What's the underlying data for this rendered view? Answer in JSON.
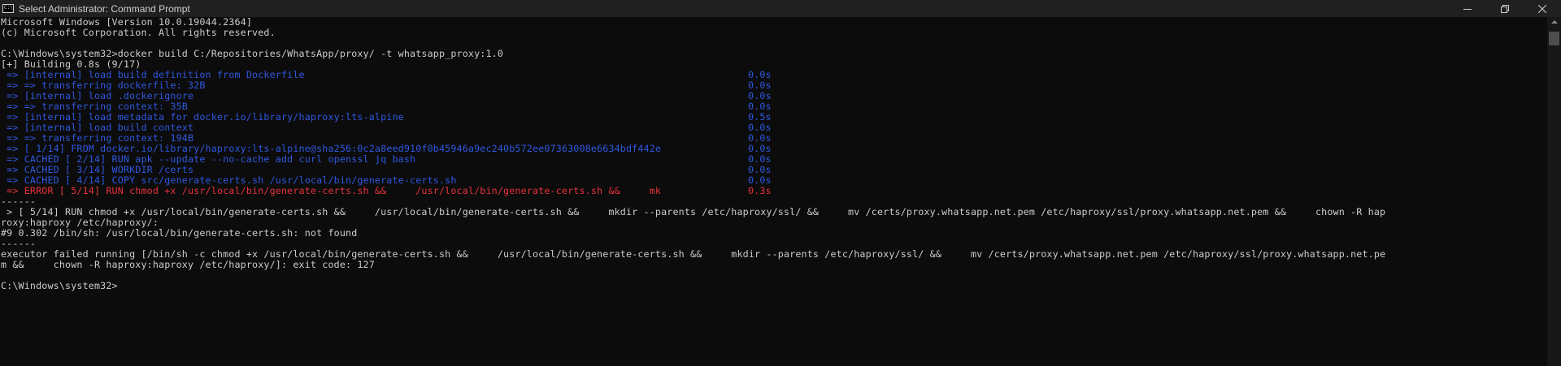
{
  "window": {
    "title": "Select Administrator: Command Prompt",
    "icon": "cmd-icon",
    "controls": [
      "minimize-icon",
      "maximize-icon",
      "close-icon"
    ]
  },
  "console": {
    "header": [
      "Microsoft Windows [Version 10.0.19044.2364]",
      "(c) Microsoft Corporation. All rights reserved."
    ],
    "command_line": "C:\\Windows\\system32>docker build C:/Repositories/WhatsApp/proxy/ -t whatsapp_proxy:1.0",
    "building": "[+] Building 0.8s (9/17)",
    "steps": [
      {
        "text": " => [internal] load build definition from Dockerfile",
        "time": "0.0s",
        "status": "ok"
      },
      {
        "text": " => => transferring dockerfile: 32B",
        "time": "0.0s",
        "status": "ok"
      },
      {
        "text": " => [internal] load .dockerignore",
        "time": "0.0s",
        "status": "ok"
      },
      {
        "text": " => => transferring context: 35B",
        "time": "0.0s",
        "status": "ok"
      },
      {
        "text": " => [internal] load metadata for docker.io/library/haproxy:lts-alpine",
        "time": "0.5s",
        "status": "ok"
      },
      {
        "text": " => [internal] load build context",
        "time": "0.0s",
        "status": "ok"
      },
      {
        "text": " => => transferring context: 194B",
        "time": "0.0s",
        "status": "ok"
      },
      {
        "text": " => [ 1/14] FROM docker.io/library/haproxy:lts-alpine@sha256:0c2a8eed910f0b45946a9ec240b572ee07363008e6634bdf442e",
        "time": "0.0s",
        "status": "ok"
      },
      {
        "text": " => CACHED [ 2/14] RUN apk --update --no-cache add curl openssl jq bash",
        "time": "0.0s",
        "status": "ok"
      },
      {
        "text": " => CACHED [ 3/14] WORKDIR /certs",
        "time": "0.0s",
        "status": "ok"
      },
      {
        "text": " => CACHED [ 4/14] COPY src/generate-certs.sh /usr/local/bin/generate-certs.sh",
        "time": "0.0s",
        "status": "ok"
      },
      {
        "text": " => ERROR [ 5/14] RUN chmod +x /usr/local/bin/generate-certs.sh &&     /usr/local/bin/generate-certs.sh &&     mk",
        "time": "0.3s",
        "status": "error"
      }
    ],
    "separator1": "------",
    "detail": [
      " > [ 5/14] RUN chmod +x /usr/local/bin/generate-certs.sh &&     /usr/local/bin/generate-certs.sh &&     mkdir --parents /etc/haproxy/ssl/ &&     mv /certs/proxy.whatsapp.net.pem /etc/haproxy/ssl/proxy.whatsapp.net.pem &&     chown -R hap",
      "roxy:haproxy /etc/haproxy/:",
      "#9 0.302 /bin/sh: /usr/local/bin/generate-certs.sh: not found"
    ],
    "separator2": "------",
    "error": [
      "executor failed running [/bin/sh -c chmod +x /usr/local/bin/generate-certs.sh &&     /usr/local/bin/generate-certs.sh &&     mkdir --parents /etc/haproxy/ssl/ &&     mv /certs/proxy.whatsapp.net.pem /etc/haproxy/ssl/proxy.whatsapp.net.pe",
      "m &&     chown -R haproxy:haproxy /etc/haproxy/]: exit code: 127"
    ],
    "prompt": "C:\\Windows\\system32>"
  },
  "colors": {
    "background": "#0c0c0c",
    "text": "#cccccc",
    "step_blue": "#2f58e0",
    "error_red": "#e8323c"
  }
}
